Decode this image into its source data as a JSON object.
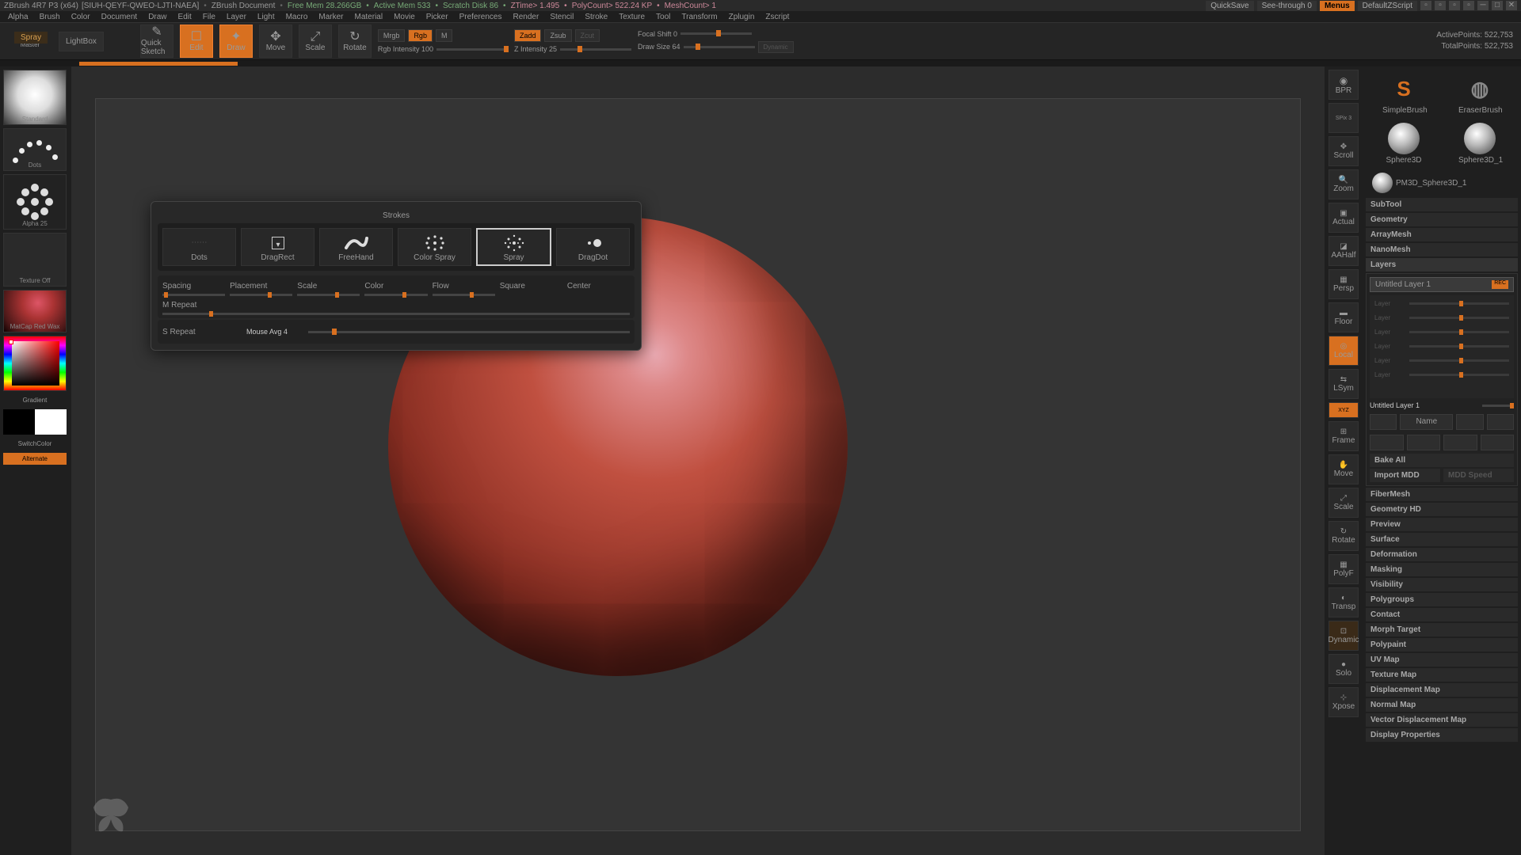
{
  "title": {
    "app": "ZBrush 4R7 P3 (x64)",
    "proj": "[SIUH-QEYF-QWEO-LJTI-NAEA]",
    "doc": "ZBrush Document",
    "freemem": "Free Mem 28.266GB",
    "activemem": "Active Mem 533",
    "scratch": "Scratch Disk 86",
    "ztime": "ZTime> 1.495",
    "poly": "PolyCount> 522.24 KP",
    "mesh": "MeshCount> 1",
    "quicksave": "QuickSave",
    "seethrough": "See-through   0",
    "menus": "Menus",
    "script": "DefaultZScript"
  },
  "menu": [
    "Alpha",
    "Brush",
    "Color",
    "Document",
    "Draw",
    "Edit",
    "File",
    "Layer",
    "Light",
    "Macro",
    "Marker",
    "Material",
    "Movie",
    "Picker",
    "Preferences",
    "Render",
    "Stencil",
    "Stroke",
    "Texture",
    "Tool",
    "Transform",
    "Zplugin",
    "Zscript"
  ],
  "tooltip": "Spray",
  "toolbar": {
    "projmaster": "Projection Master",
    "lightbox": "LightBox",
    "quicksketch": "Quick Sketch",
    "edit": "Edit",
    "draw": "Draw",
    "move": "Move",
    "scale": "Scale",
    "rotate": "Rotate",
    "mrgb": "Mrgb",
    "rgb": "Rgb",
    "m": "M",
    "rgbint": "Rgb Intensity 100",
    "zadd": "Zadd",
    "zsub": "Zsub",
    "zcut": "Zcut",
    "zint": "Z Intensity 25",
    "focal": "Focal Shift 0",
    "drawsize": "Draw Size 64",
    "dynamic": "Dynamic",
    "active": "ActivePoints: 522,753",
    "total": "TotalPoints: 522,753"
  },
  "left": {
    "brush": "Standard",
    "stroke": "Dots",
    "alpha": "Alpha 25",
    "texture": "Texture Off",
    "material": "MatCap Red Wax",
    "gradient": "Gradient",
    "switchcol": "SwitchColor",
    "alternate": "Alternate"
  },
  "strokepanel": {
    "title": "Strokes",
    "types": [
      "Dots",
      "DragRect",
      "FreeHand",
      "Color Spray",
      "Spray",
      "DragDot"
    ],
    "params": [
      "Spacing",
      "Placement",
      "Scale",
      "Color",
      "Flow",
      "Square",
      "Center",
      "M Repeat",
      "S Repeat"
    ],
    "mouseavg": "Mouse Avg 4"
  },
  "rightp": [
    "BPR",
    "SPix 3",
    "Scroll",
    "Zoom",
    "Actual",
    "AAHalf",
    "Persp",
    "Floor",
    "Local",
    "LSym",
    "XYZ",
    "Frame",
    "Move",
    "Scale",
    "Rotate",
    "PolyF",
    "Transp",
    "Dynamic",
    "Solo",
    "Xpose"
  ],
  "tools": {
    "s1": "SimpleBrush",
    "s2": "EraserBrush",
    "s3": "Sphere3D",
    "s4": "Sphere3D_1",
    "s5": "PM3D_Sphere3D_1"
  },
  "sections": {
    "subtool": "SubTool",
    "geometry": "Geometry",
    "arraymesh": "ArrayMesh",
    "nanomesh": "NanoMesh",
    "layers": "Layers",
    "fibermesh": "FiberMesh",
    "geohd": "Geometry HD",
    "preview": "Preview",
    "surface": "Surface",
    "deformation": "Deformation",
    "masking": "Masking",
    "visibility": "Visibility",
    "polygroups": "Polygroups",
    "contact": "Contact",
    "morph": "Morph Target",
    "polypaint": "Polypaint",
    "uvmap": "UV Map",
    "texmap": "Texture Map",
    "dispmap": "Displacement Map",
    "normmap": "Normal Map",
    "vecdisp": "Vector Displacement Map",
    "dispprop": "Display Properties"
  },
  "layers": {
    "current": "Untitled Layer 1",
    "sub": "Untitled Layer 1",
    "rec": "REC",
    "name": "Name",
    "bakeall": "Bake All",
    "importmdd": "Import MDD",
    "mddspeed": "MDD Speed",
    "dimrows": [
      "Layer",
      "Layer",
      "Layer",
      "Layer",
      "Layer",
      "Layer"
    ]
  }
}
